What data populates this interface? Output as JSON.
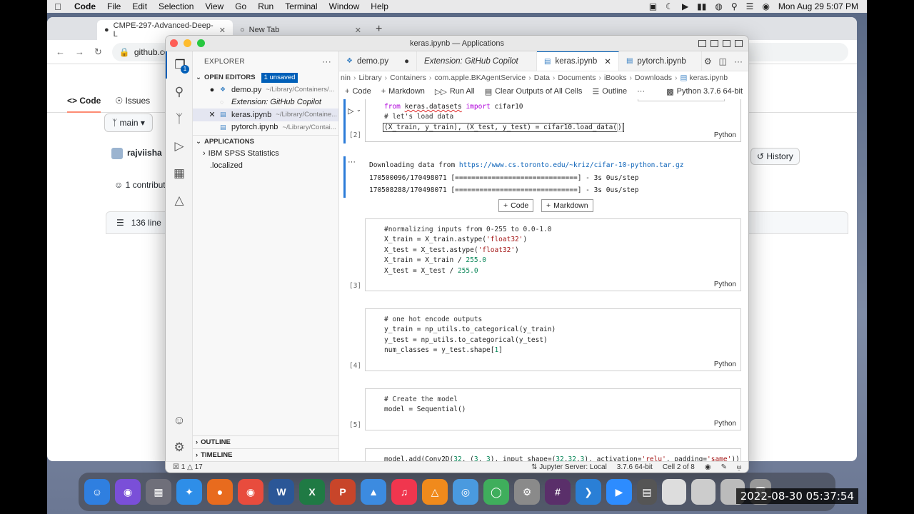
{
  "menubar": {
    "app": "Code",
    "items": [
      "File",
      "Edit",
      "Selection",
      "View",
      "Go",
      "Run",
      "Terminal",
      "Window",
      "Help"
    ],
    "datetime": "Mon Aug 29  5:07 PM"
  },
  "browser": {
    "tabs": [
      {
        "label": "CMPE-297-Advanced-Deep-L"
      },
      {
        "label": "New Tab"
      }
    ],
    "url": "github.co",
    "gh_nav": {
      "code": "Code",
      "issues": "Issues"
    },
    "branch": "main",
    "user": "rajviisha",
    "contributors": "1 contribut",
    "lines": "136 line",
    "history": "History"
  },
  "vscode": {
    "title": "keras.ipynb — Applications",
    "explorer": {
      "header": "EXPLORER",
      "open_editors": "OPEN EDITORS",
      "unsaved": "1 unsaved",
      "editors": [
        {
          "name": "demo.py",
          "path": "~/Library/Containers/..."
        },
        {
          "name": "Extension: GitHub Copilot",
          "path": ""
        },
        {
          "name": "keras.ipynb",
          "path": "~/Library/Containe..."
        },
        {
          "name": "pytorch.ipynb",
          "path": "~/Library/Contai..."
        }
      ],
      "applications": "APPLICATIONS",
      "tree": [
        {
          "label": "IBM SPSS Statistics"
        },
        {
          "label": ".localized"
        }
      ],
      "outline": "OUTLINE",
      "timeline": "TIMELINE"
    },
    "tabs": [
      {
        "label": "demo.py"
      },
      {
        "label": "Extension: GitHub Copilot"
      },
      {
        "label": "keras.ipynb"
      },
      {
        "label": "pytorch.ipynb"
      }
    ],
    "breadcrumbs": [
      "nin",
      "Library",
      "Containers",
      "com.apple.BKAgentService",
      "Data",
      "Documents",
      "iBooks",
      "Downloads",
      "keras.ipynb"
    ],
    "toolbar": {
      "code": "Code",
      "markdown": "Markdown",
      "run_all": "Run All",
      "clear": "Clear Outputs of All Cells",
      "outline": "Outline",
      "kernel": "Python 3.7.6 64-bit"
    },
    "cells": {
      "c2": {
        "num": "[2]",
        "lang": "Python"
      },
      "output": {
        "line1_prefix": "Downloading data from ",
        "line1_url": "https://www.cs.toronto.edu/~kriz/cifar-10-python.tar.gz",
        "line2": "170500096/170498071 [==============================] - 3s 0us/step",
        "line3": "170508288/170498071 [==============================] - 3s 0us/step"
      },
      "add_code": "Code",
      "add_markdown": "Markdown",
      "c3": {
        "num": "[3]",
        "lang": "Python"
      },
      "c4": {
        "num": "[4]",
        "lang": "Python"
      },
      "c5": {
        "num": "[5]",
        "lang": "Python"
      }
    },
    "status": {
      "errors": "1",
      "warnings": "17",
      "jupyter": "Jupyter Server: Local",
      "version": "3.7.6 64-bit",
      "cell": "Cell 2 of 8"
    }
  },
  "timestamp": "2022-08-30 05:37:54"
}
